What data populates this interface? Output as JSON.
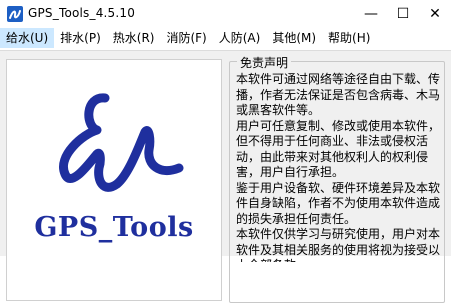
{
  "window": {
    "title": "GPS_Tools_4.5.10",
    "min_glyph": "—",
    "max_glyph": "☐",
    "close_glyph": "✕"
  },
  "menu": [
    "给水(U)",
    "排水(P)",
    "热水(R)",
    "消防(F)",
    "人防(A)",
    "其他(M)",
    "帮助(H)"
  ],
  "logo": {
    "text": "GPS_Tools",
    "color": "#1f2f9e"
  },
  "disclaimer": {
    "legend": "免责声明",
    "text": "本软件可通过网络等途径自由下载、传播，作者无法保证是否包含病毒、木马或黑客软件等。\n用户可任意复制、修改或使用本软件，但不得用于任何商业、非法或侵权活动，由此带来对其他权利人的权利侵害，用户自行承担。\n鉴于用户设备软、硬件环境差异及本软件自身缺陷，作者不为使用本软件造成的损失承担任何责任。\n本软件仅供学习与研究使用，用户对本软件及其相关服务的使用将视为接受以上全部条款。"
  }
}
